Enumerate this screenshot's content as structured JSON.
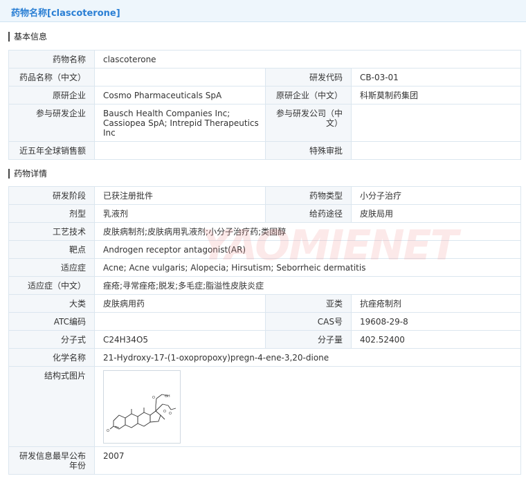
{
  "page_title": "药物名称[clascoterone]",
  "sections": {
    "basic": "基本信息",
    "detail": "药物详情"
  },
  "basic": {
    "drug_name_label": "药物名称",
    "drug_name": "clascoterone",
    "drug_cn_label": "药品名称（中文）",
    "drug_cn": "",
    "code_label": "研发代码",
    "code": "CB-03-01",
    "orig_label": "原研企业",
    "orig": "Cosmo Pharmaceuticals SpA",
    "orig_cn_label": "原研企业（中文）",
    "orig_cn": "科斯莫制药集团",
    "partner_label": "参与研发企业",
    "partner": "Bausch Health Companies Inc; Cassiopea SpA; Intrepid Therapeutics Inc",
    "partner_cn_label": "参与研发公司（中文）",
    "partner_cn": "",
    "sales_label": "近五年全球销售额",
    "sales": "",
    "special_label": "特殊审批",
    "special": ""
  },
  "detail": {
    "stage_label": "研发阶段",
    "stage": "已获注册批件",
    "type_label": "药物类型",
    "type": "小分子治疗",
    "form_label": "剂型",
    "form": "乳液剂",
    "route_label": "给药途径",
    "route": "皮肤局用",
    "tech_label": "工艺技术",
    "tech": "皮肤病制剂;皮肤病用乳液剂;小分子治疗药;类固醇",
    "target_label": "靶点",
    "target": "Androgen receptor antagonist(AR)",
    "indication_label": "适应症",
    "indication": "Acne; Acne vulgaris; Alopecia; Hirsutism; Seborrheic dermatitis",
    "indication_cn_label": "适应症（中文）",
    "indication_cn": "痤疮;寻常痤疮;脱发;多毛症;脂溢性皮肤炎症",
    "class_label": "大类",
    "class": "皮肤病用药",
    "subclass_label": "亚类",
    "subclass": "抗痤疮制剂",
    "atc_label": "ATC编码",
    "atc": "",
    "cas_label": "CAS号",
    "cas": "19608-29-8",
    "formula_label": "分子式",
    "formula": "C24H34O5",
    "mw_label": "分子量",
    "mw": "402.52400",
    "chem_label": "化学名称",
    "chem": "21-Hydroxy-17-(1-oxopropoxy)pregn-4-ene-3,20-dione",
    "struct_label": "结构式图片",
    "first_pub_label": "研发信息最早公布年份",
    "first_pub": "2007"
  },
  "watermark": "YAOMIENET",
  "colors": {
    "title_blue": "#2a7fd4",
    "label_bg": "#f4f7fa",
    "border": "#dbe6ef",
    "header_bg": "#eef6fc"
  }
}
